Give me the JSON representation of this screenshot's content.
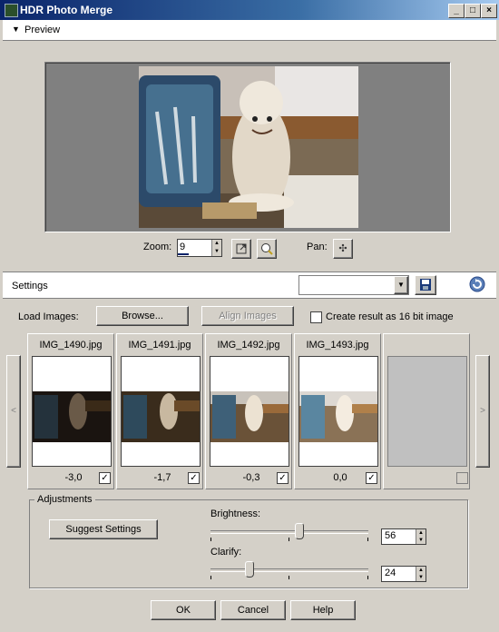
{
  "window": {
    "title": "HDR Photo Merge",
    "min_icon": "minimize-icon",
    "max_icon": "maximize-icon",
    "close_icon": "close-icon"
  },
  "preview": {
    "label": "Preview",
    "zoom_label": "Zoom:",
    "zoom_value": "9",
    "pan_label": "Pan:"
  },
  "settings": {
    "label": "Settings",
    "preset_value": ""
  },
  "load": {
    "label": "Load Images:",
    "browse": "Browse...",
    "align": "Align Images",
    "create16": "Create result as 16 bit image"
  },
  "thumbs": [
    {
      "name": "IMG_1490.jpg",
      "value": "-3,0",
      "checked": true
    },
    {
      "name": "IMG_1491.jpg",
      "value": "-1,7",
      "checked": true
    },
    {
      "name": "IMG_1492.jpg",
      "value": "-0,3",
      "checked": true
    },
    {
      "name": "IMG_1493.jpg",
      "value": "0,0",
      "checked": true
    }
  ],
  "adjustments": {
    "label": "Adjustments",
    "suggest": "Suggest Settings",
    "brightness_label": "Brightness:",
    "brightness_value": "56",
    "clarify_label": "Clarify:",
    "clarify_value": "24"
  },
  "buttons": {
    "ok": "OK",
    "cancel": "Cancel",
    "help": "Help"
  },
  "colors": {
    "title_start": "#0a246a",
    "title_end": "#a6caf0",
    "face": "#d4d0c8",
    "preview_bg": "#808080"
  }
}
